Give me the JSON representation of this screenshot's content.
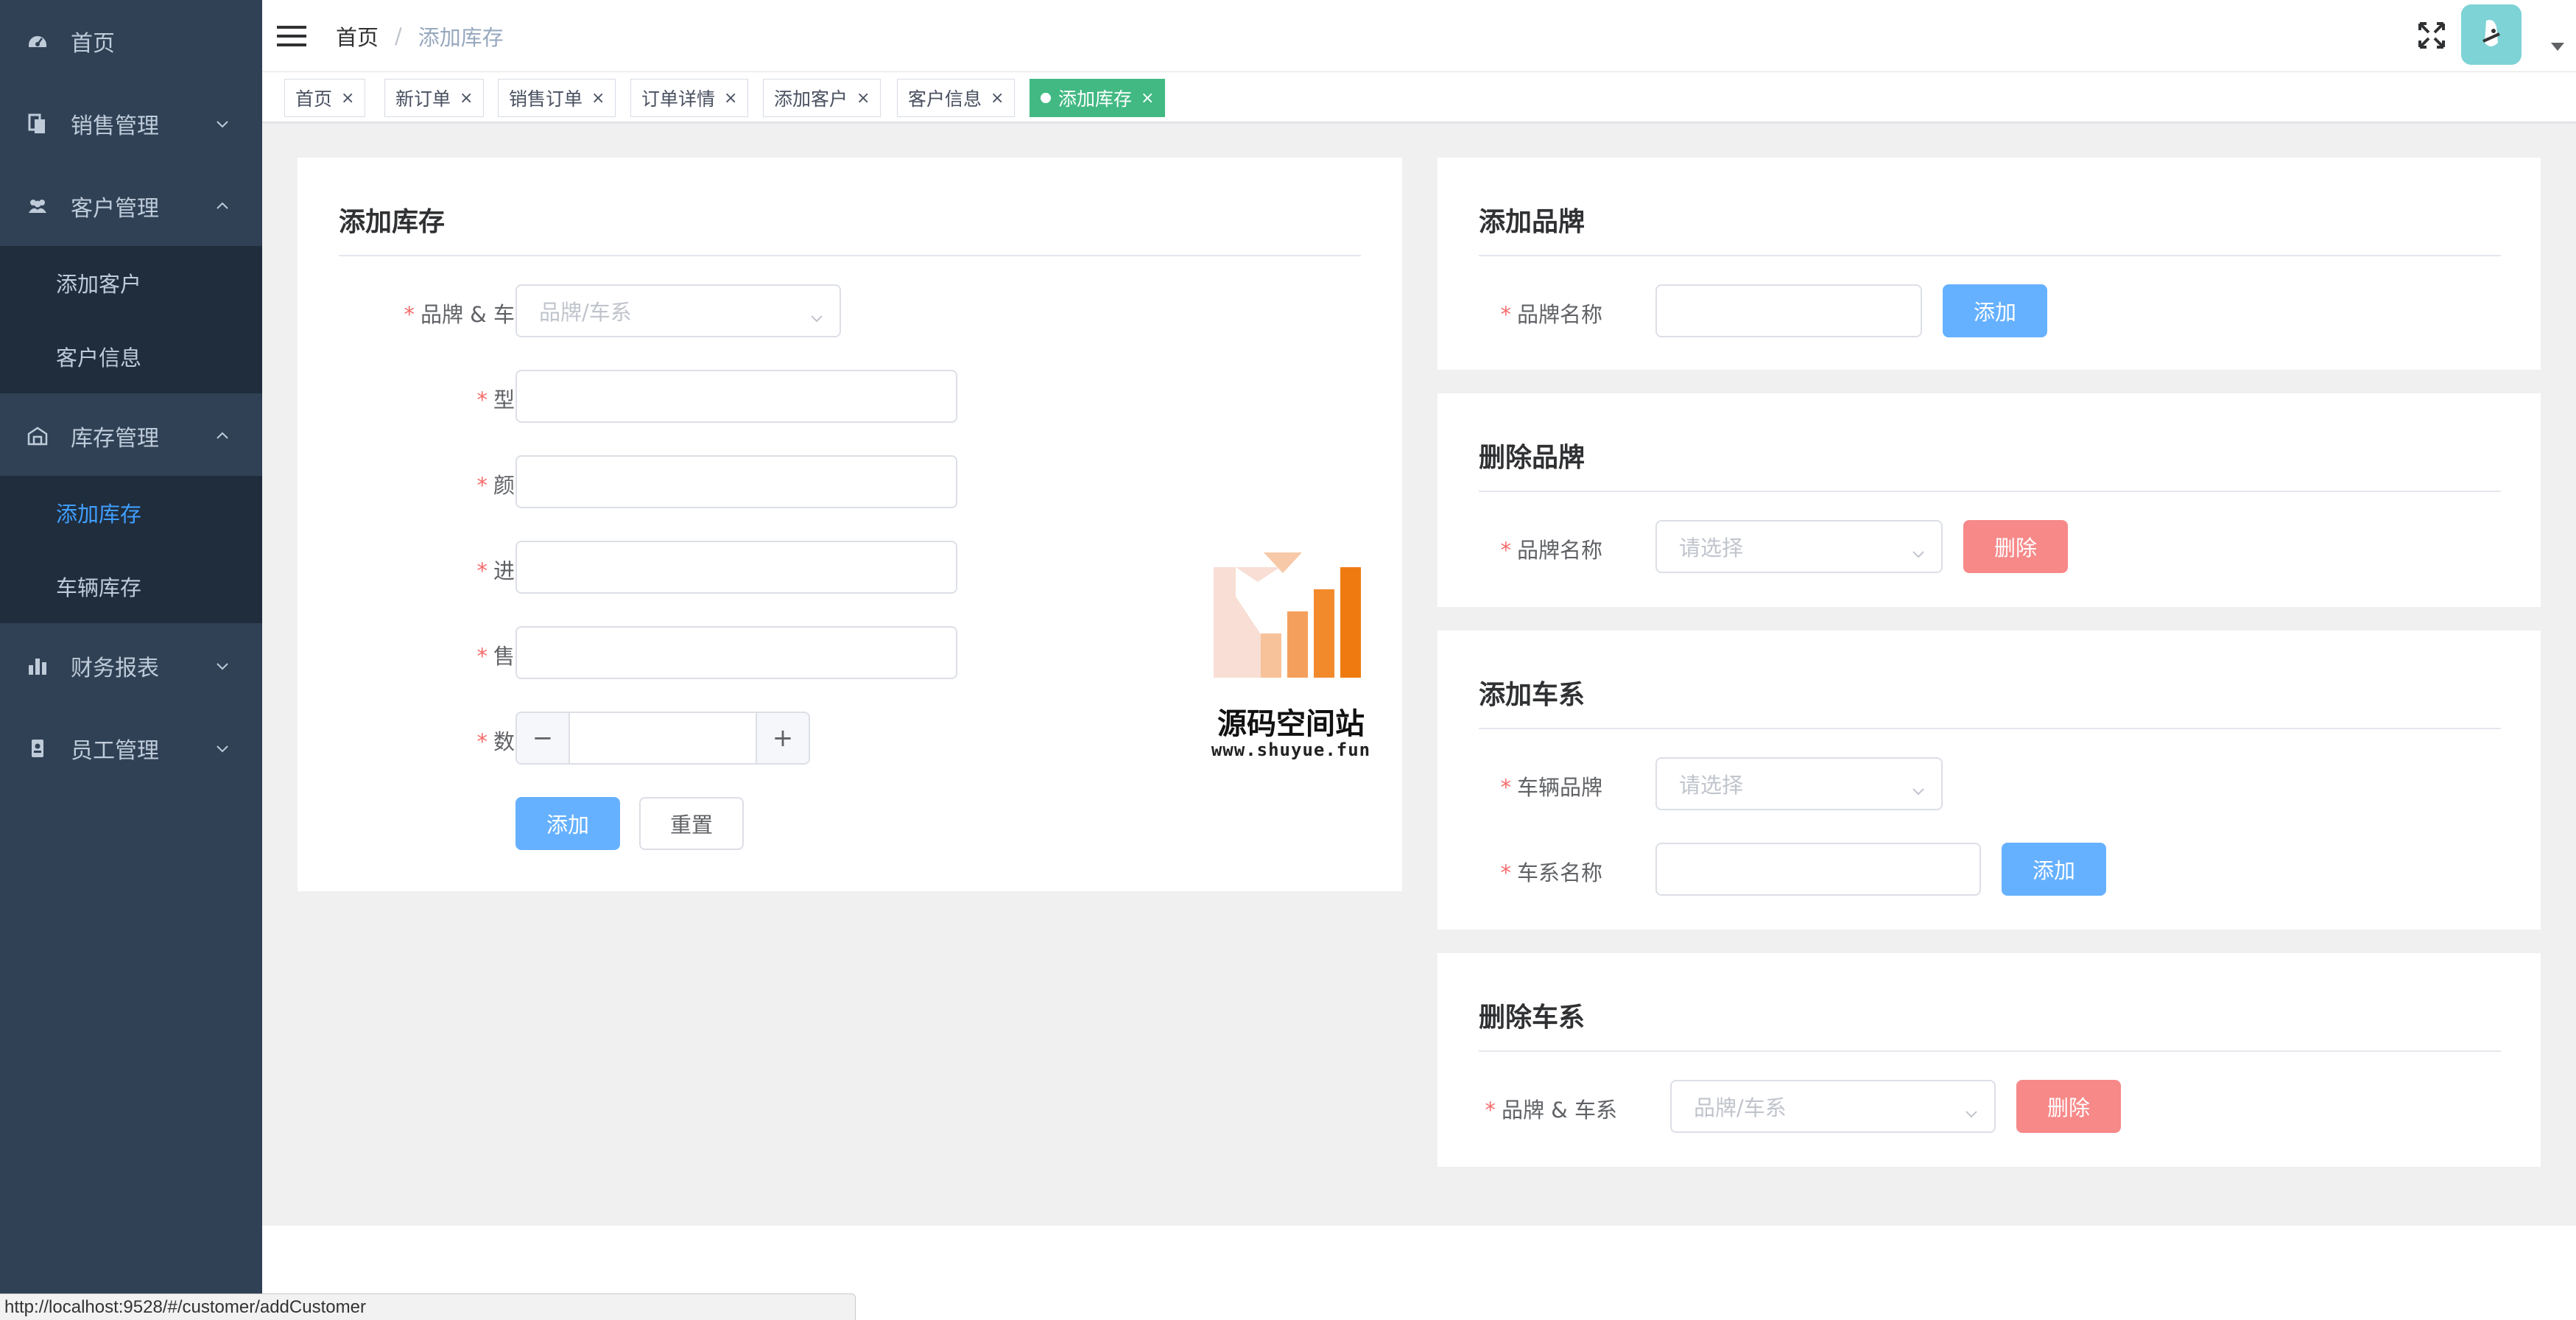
{
  "sidebar": {
    "items": [
      {
        "label": "首页",
        "icon": "dashboard-icon"
      },
      {
        "label": "销售管理",
        "icon": "documents-icon"
      },
      {
        "label": "客户管理",
        "icon": "people-icon"
      },
      {
        "label": "库存管理",
        "icon": "warehouse-icon"
      },
      {
        "label": "财务报表",
        "icon": "bar-chart-icon"
      },
      {
        "label": "员工管理",
        "icon": "badge-icon"
      }
    ],
    "customer_sub": [
      {
        "label": "添加客户"
      },
      {
        "label": "客户信息"
      }
    ],
    "inventory_sub": [
      {
        "label": "添加库存",
        "active": true
      },
      {
        "label": "车辆库存"
      }
    ]
  },
  "navbar": {
    "breadcrumb_home": "首页",
    "breadcrumb_sep": "/",
    "breadcrumb_current": "添加库存"
  },
  "tags": [
    {
      "label": "首页"
    },
    {
      "label": "新订单"
    },
    {
      "label": "销售订单"
    },
    {
      "label": "订单详情"
    },
    {
      "label": "添加客户"
    },
    {
      "label": "客户信息"
    },
    {
      "label": "添加库存",
      "active": true
    }
  ],
  "tag_close": "×",
  "add_inventory": {
    "title": "添加库存",
    "brand_series_label": "品牌 & 车系",
    "brand_series_placeholder": "品牌/车系",
    "model_label": "型号",
    "color_label": "颜色",
    "purchase_price_label": "进价",
    "sale_price_label": "售价",
    "quantity_label": "数量",
    "quantity_minus": "−",
    "quantity_plus": "+",
    "submit_label": "添加",
    "reset_label": "重置"
  },
  "add_brand": {
    "title": "添加品牌",
    "name_label": "品牌名称",
    "submit_label": "添加"
  },
  "delete_brand": {
    "title": "删除品牌",
    "name_label": "品牌名称",
    "placeholder": "请选择",
    "submit_label": "删除"
  },
  "add_series": {
    "title": "添加车系",
    "brand_label": "车辆品牌",
    "brand_placeholder": "请选择",
    "name_label": "车系名称",
    "submit_label": "添加"
  },
  "delete_series": {
    "title": "删除车系",
    "brand_series_label": "品牌 & 车系",
    "placeholder": "品牌/车系",
    "submit_label": "删除"
  },
  "watermark": {
    "title": "源码空间站",
    "url": "www.shuyue.fun"
  },
  "status_bar": {
    "url": "http://localhost:9528/#/customer/addCustomer"
  },
  "colors": {
    "sidebar_bg": "#304156",
    "submenu_bg": "#1f2d3d",
    "active_tag": "#42b983",
    "primary": "#66b1ff",
    "danger": "#f78989"
  }
}
